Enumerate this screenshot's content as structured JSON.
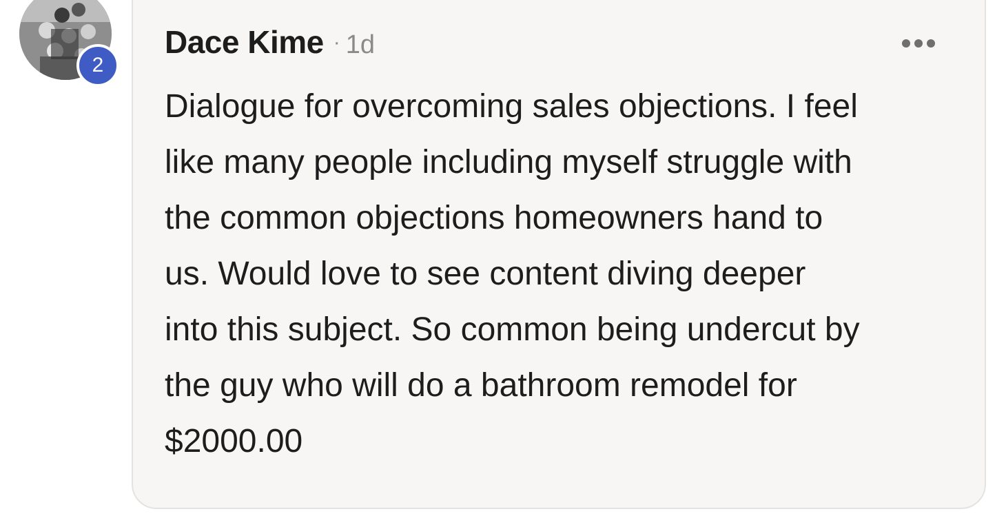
{
  "comment": {
    "author": "Dace Kime",
    "separator": "·",
    "timestamp": "1d",
    "avatar_badge_count": "2",
    "more_icon": "more-horizontal-icon",
    "body_lines": [
      "Dialogue for overcoming sales objections. I feel",
      "like many people including myself struggle with",
      "the common objections homeowners hand to",
      "us. Would love to see content diving deeper",
      "into this subject. So common being undercut by",
      "the guy who will do a bathroom remodel for",
      "$2000.00"
    ]
  },
  "colors": {
    "badge": "#3f5bc4",
    "bubble_background": "#f7f6f5",
    "text": "#1d1d1d",
    "muted_text": "#8a8a8a"
  }
}
